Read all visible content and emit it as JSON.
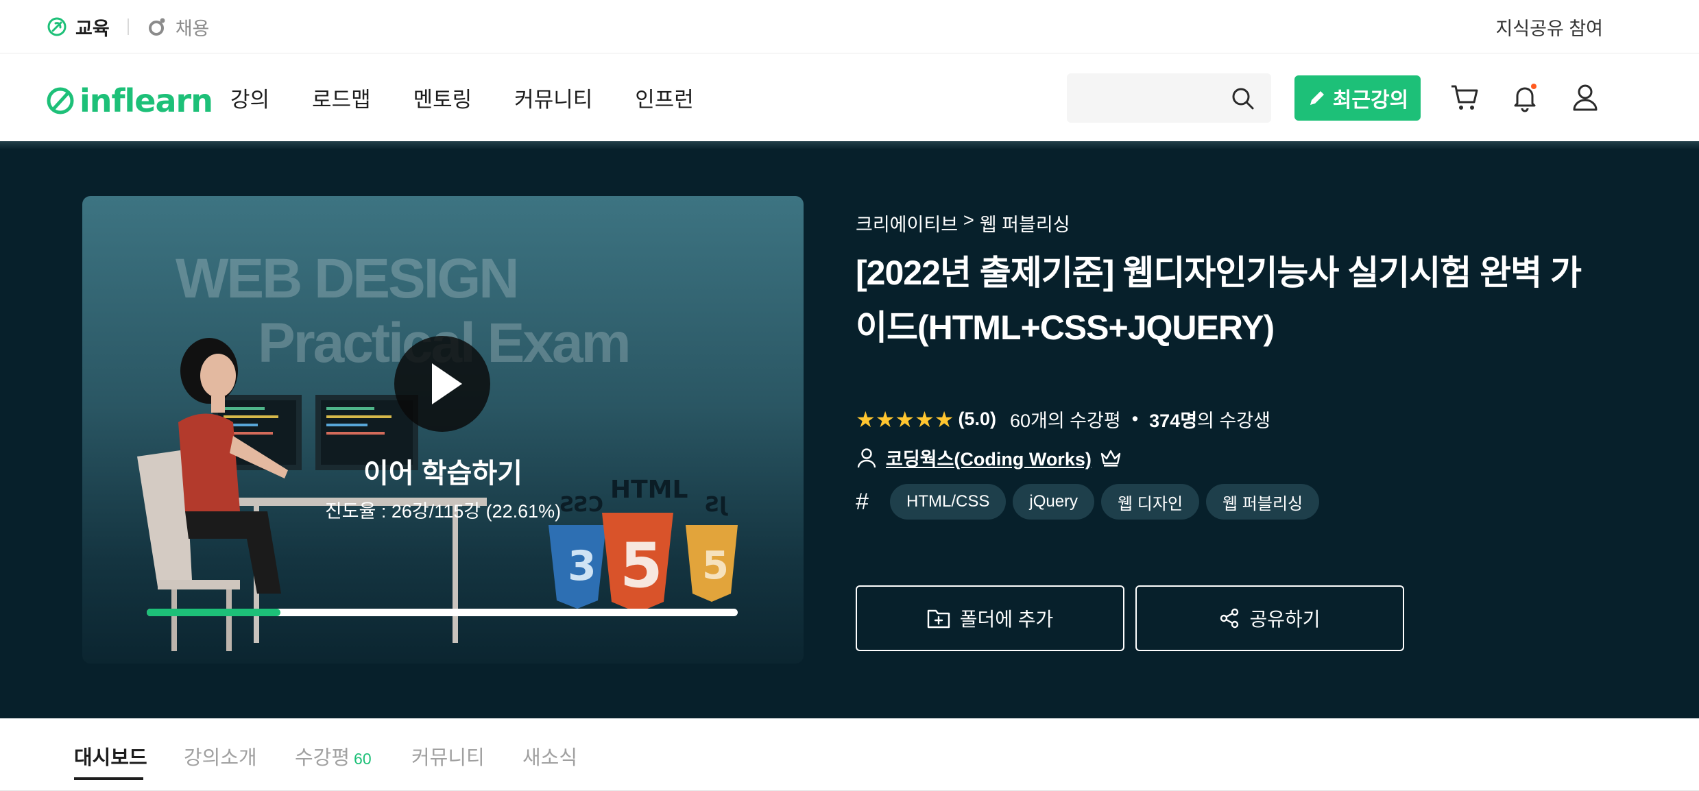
{
  "topbar": {
    "segments": [
      {
        "label": "교육",
        "icon": "sprout-leaf-icon"
      },
      {
        "label": "채용",
        "icon": "rally-circle-icon"
      }
    ],
    "right_link": "지식공유 참여"
  },
  "header": {
    "logo": "inflearn",
    "nav": [
      "강의",
      "로드맵",
      "멘토링",
      "커뮤니티",
      "인프런"
    ],
    "search": {
      "value": "",
      "placeholder": ""
    },
    "recent_button": "최근강의",
    "icons": [
      "search-icon",
      "pencil-icon",
      "cart-icon",
      "bell-icon",
      "user-icon"
    ],
    "accent_color": "#1dc078",
    "notification_dot_color": "#ff5a1f"
  },
  "hero": {
    "background": "#07202b",
    "thumbnail": {
      "text_line1": "WEB DESIGN",
      "text_line2": "Practical Exam",
      "badges": [
        "HTML",
        "CSS",
        "JS"
      ],
      "resume_label": "이어 학습하기",
      "progress_text": "진도율 : 26강/115강 (22.61%)",
      "progress_fraction": 0.2261
    },
    "breadcrumb": [
      "크리에이티브",
      ">",
      "웹 퍼블리싱"
    ],
    "title": "[2022년 출제기준] 웹디자인기능사 실기시험 완벽 가이드(HTML+CSS+JQUERY)",
    "rating": {
      "stars": "★★★★★",
      "score": "(5.0)",
      "reviews": "60개의 수강평",
      "separator": "•",
      "students_count": "374명",
      "students_suffix": "의 수강생"
    },
    "author": "코딩웍스(Coding Works)",
    "tags": [
      "HTML/CSS",
      "jQuery",
      "웹 디자인",
      "웹 퍼블리싱"
    ],
    "buttons": {
      "folder": "폴더에 추가",
      "share": "공유하기"
    }
  },
  "tabs": [
    {
      "label": "대시보드",
      "count": ""
    },
    {
      "label": "강의소개",
      "count": ""
    },
    {
      "label": "수강평",
      "count": "60"
    },
    {
      "label": "커뮤니티",
      "count": ""
    },
    {
      "label": "새소식",
      "count": ""
    }
  ]
}
